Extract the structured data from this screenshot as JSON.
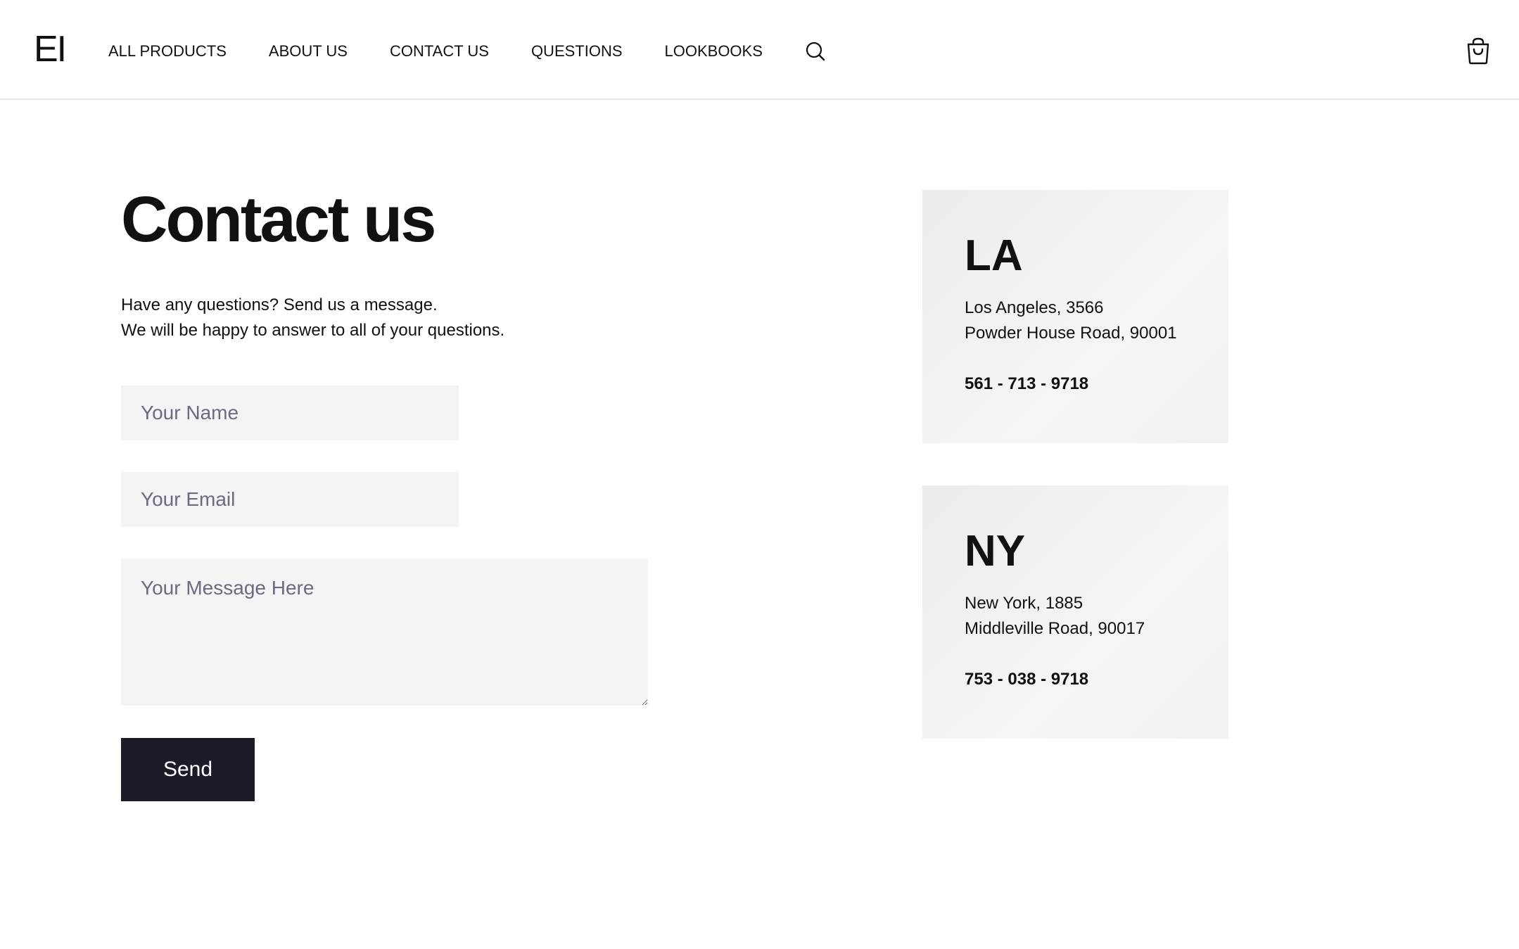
{
  "header": {
    "logo": "EI",
    "nav": [
      "ALL PRODUCTS",
      "ABOUT US",
      "CONTACT US",
      "QUESTIONS",
      "LOOKBOOKS"
    ],
    "search_icon": "search-icon",
    "cart_icon": "shopping-bag-icon"
  },
  "main": {
    "title": "Contact us",
    "intro_lines": [
      "Have any questions? Send us a message.",
      "We will be happy to answer to all of your questions."
    ],
    "form": {
      "name_placeholder": "Your Name",
      "email_placeholder": "Your Email",
      "message_placeholder": "Your Message Here",
      "send_label": "Send"
    }
  },
  "locations": [
    {
      "title": "LA",
      "address_lines": [
        "Los Angeles, 3566",
        "Powder House Road, 90001"
      ],
      "phone": "561 - 713 - 9718"
    },
    {
      "title": "NY",
      "address_lines": [
        "New York, 1885",
        "Middleville Road, 90017"
      ],
      "phone": "753 - 038 - 9718"
    }
  ],
  "colors": {
    "button_bg": "#1c1c28",
    "field_bg": "#f4f4f4",
    "card_bg": "#f2f2f2",
    "placeholder": "#6b6b80"
  }
}
